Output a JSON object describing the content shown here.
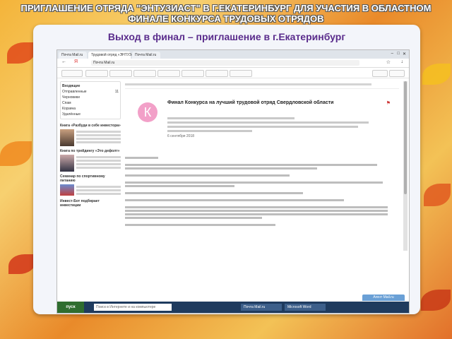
{
  "slide": {
    "title": "ПРИГЛАШЕНИЕ ОТРЯДА \"ЭНТУЗИАСТ\" В Г.ЕКАТЕРИНБУРГ ДЛЯ УЧАСТИЯ В ОБЛАСТНОМ ФИНАЛЕ КОНКУРСА ТРУДОВЫХ ОТРЯДОВ",
    "subtitle": "Выход в финал – приглашение в г.Екатеринбург"
  },
  "browser": {
    "tabs": [
      "Почта Mail.ru",
      "Трудовой отряд «ЭНТУЗ»",
      "Почта Mail.ru"
    ],
    "address": "Почта Mail.ru"
  },
  "sidebar": {
    "folders": [
      {
        "label": "Входящие",
        "count": ""
      },
      {
        "label": "Отправленные",
        "count": "11"
      },
      {
        "label": "Черновики",
        "count": ""
      },
      {
        "label": "Спам",
        "count": ""
      },
      {
        "label": "Корзина",
        "count": ""
      },
      {
        "label": "Удалённые",
        "count": ""
      }
    ],
    "news": [
      {
        "title": "Книга «Разбуди в себе инвестора»"
      },
      {
        "title": "Книга по трейдингу «Это дефолт»"
      },
      {
        "title": "Семинар по спортивному питанию"
      },
      {
        "title": "Инвест-Бот подбирает инвестиции"
      }
    ]
  },
  "email": {
    "avatar_letter": "К",
    "subject": "Финал Конкурса на лучший трудовой отряд Свердловской области",
    "date": "6 сентября 2018"
  },
  "taskbar": {
    "start": "пуск",
    "search": "Поиск в Интернете и на компьютере",
    "tasks": [
      "Почта Mail.ru",
      "Microsoft Word"
    ],
    "chat": "Агент Mail.ru"
  },
  "colors": {
    "subtitle": "#5a2c8c",
    "avatar": "#f2a0c8",
    "taskbar": "#1f3b5e"
  }
}
